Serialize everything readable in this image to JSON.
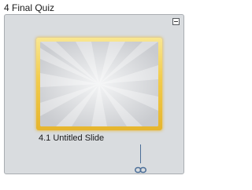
{
  "group": {
    "title": "4 Final Quiz"
  },
  "slide": {
    "label": "4.1 Untitled Slide"
  },
  "icons": {
    "collapse": "minus-box-icon",
    "link": "chain-link-icon"
  },
  "colors": {
    "selection": "#f2cc4c",
    "panel": "#d9dcdf",
    "connector": "#4b6e98"
  }
}
